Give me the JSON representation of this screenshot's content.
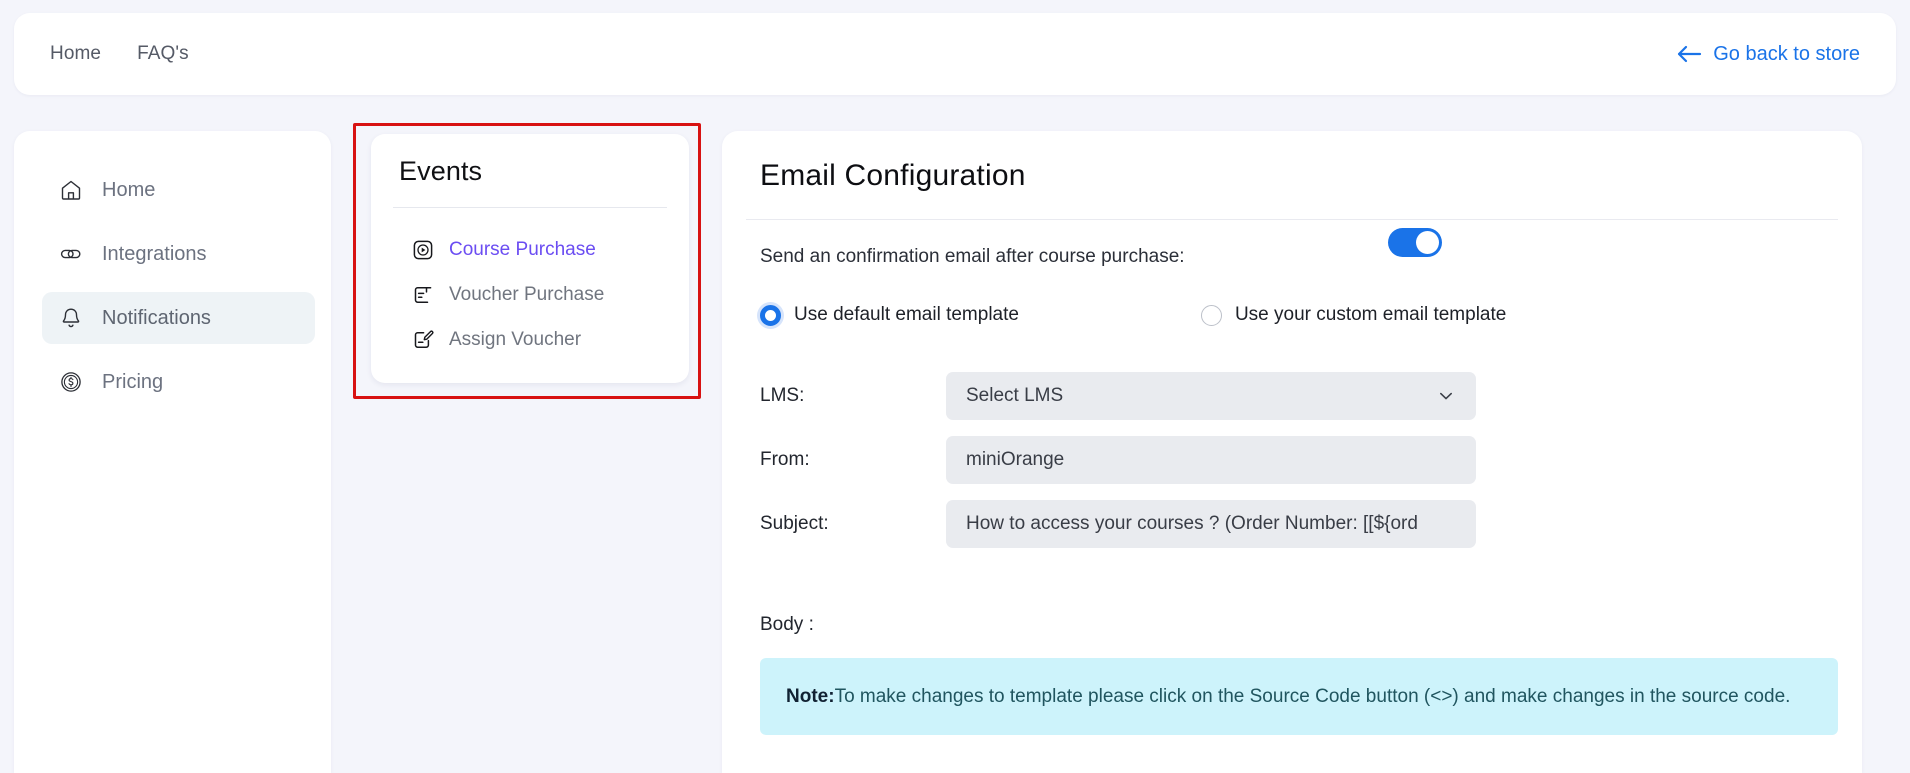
{
  "topbar": {
    "nav": [
      {
        "label": "Home"
      },
      {
        "label": "FAQ's"
      }
    ],
    "back_link": {
      "label": "Go back to store",
      "icon": "arrow-left-icon",
      "color": "#1a73e8"
    }
  },
  "sidebar": {
    "items": [
      {
        "label": "Home",
        "icon": "home-icon",
        "active": false
      },
      {
        "label": "Integrations",
        "icon": "link-icon",
        "active": false
      },
      {
        "label": "Notifications",
        "icon": "bell-icon",
        "active": true
      },
      {
        "label": "Pricing",
        "icon": "dollar-coin-icon",
        "active": false
      }
    ]
  },
  "events_panel": {
    "title": "Events",
    "highlight_color": "#d81212",
    "selected_color": "#6b4df2",
    "items": [
      {
        "label": "Course Purchase",
        "icon": "play-square-icon",
        "selected": true
      },
      {
        "label": "Voucher Purchase",
        "icon": "voucher-icon",
        "selected": false
      },
      {
        "label": "Assign Voucher",
        "icon": "voucher-edit-icon",
        "selected": false
      }
    ]
  },
  "main": {
    "title": "Email Configuration",
    "toggle_row": {
      "label": "Send an confirmation email after course purchase:",
      "toggle_on": true,
      "toggle_color": "#1a73e8"
    },
    "template_choice": {
      "options": [
        {
          "label": "Use default email template",
          "checked": true
        },
        {
          "label": "Use your custom email template",
          "checked": false
        }
      ],
      "accent": "#1a73e8"
    },
    "fields": [
      {
        "label": "LMS:",
        "value": "Select LMS",
        "type": "select",
        "icon": "chevron-down-icon"
      },
      {
        "label": "From:",
        "value": "miniOrange",
        "type": "text"
      },
      {
        "label": "Subject:",
        "value": "How to access your courses ? (Order Number: [[${ord",
        "type": "text"
      }
    ],
    "body_label": "Body :",
    "note": {
      "prefix": "Note:",
      "text": "To make changes to template please click on the Source Code button (<>) and make changes in the source code.",
      "background": "#cdf3fb"
    }
  }
}
